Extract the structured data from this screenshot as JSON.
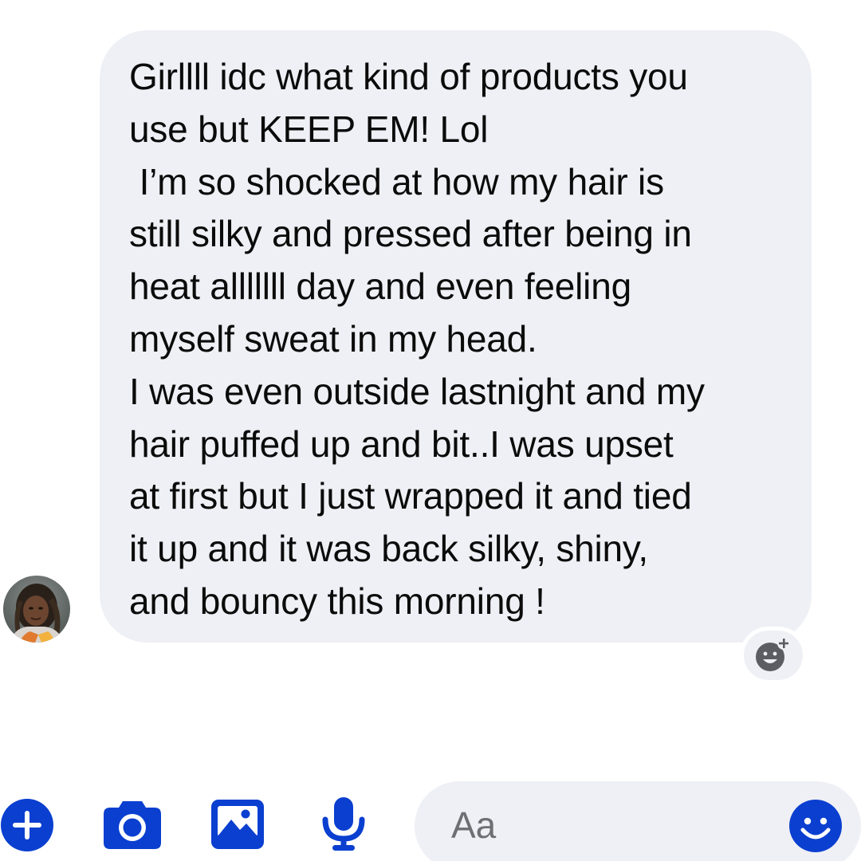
{
  "conversation": {
    "message": {
      "lines": [
        "Girllll idc what kind of products you",
        "use but KEEP EM! Lol",
        " I’m so shocked at how my hair is",
        "still silky and pressed after being in",
        "heat alllllll day and even feeling",
        "myself sweat in my head.",
        "I was even outside lastnight and my",
        "hair puffed up and bit..I was upset",
        "at first but I just wrapped it and tied",
        "it up and it was back silky, shiny,",
        "and bouncy this morning !"
      ],
      "bubble_color": "#eff0f5"
    },
    "avatar_icon": "sender-avatar",
    "reaction_icon": "add-reaction-icon"
  },
  "composer": {
    "accent_color": "#0a3fd0",
    "icons": [
      "plus-icon",
      "camera-icon",
      "image-icon",
      "microphone-icon",
      "emoji-icon"
    ],
    "input": {
      "placeholder": "Aa"
    }
  }
}
